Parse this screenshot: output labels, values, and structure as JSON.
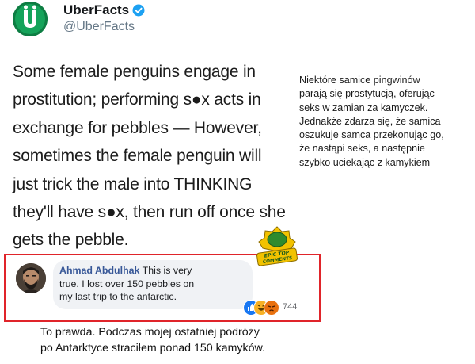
{
  "tweet": {
    "account_name": "UberFacts",
    "handle": "@UberFacts",
    "lines": [
      "Some female penguins engage in",
      "prostitution; performing s●x acts in",
      "exchange for pebbles — However,",
      "sometimes the female penguin will",
      "just trick the male into THINKING",
      "they'll have s●x, then run off once she",
      "gets the pebble."
    ]
  },
  "caption_right": {
    "lines": [
      "Niektóre samice pingwinów",
      "parają się prostytucją, oferując",
      "seks w zamian za kamyczek.",
      "Jednakże zdarza się, że samica",
      "oszukuje samca przekonując go,",
      "że nastąpi seks, a następnie",
      "szybko uciekając z kamykiem"
    ]
  },
  "badge": {
    "line1": "EPIC TOP",
    "line2": "COMMENTS",
    "colors": {
      "gold": "#f2c200",
      "green": "#2e8b2e"
    }
  },
  "comment": {
    "author": "Ahmad Abdulhak",
    "text_line1": " This is very",
    "text_line2": "true. I lost over 150 pebbles on",
    "text_line3": "my last trip to the antarctic.",
    "reaction_count": "744",
    "reaction_icons": [
      "like-icon",
      "haha-icon",
      "angry-icon"
    ]
  },
  "caption_bottom": {
    "line1": "To prawda. Podczas mojej ostatniej podróży",
    "line2": "po Antarktyce straciłem ponad 150 kamyków."
  },
  "colors": {
    "highlight_border": "#e0242a",
    "uberfacts_green": "#15a35a",
    "verified_blue": "#1da1f2",
    "fb_link": "#385898"
  }
}
